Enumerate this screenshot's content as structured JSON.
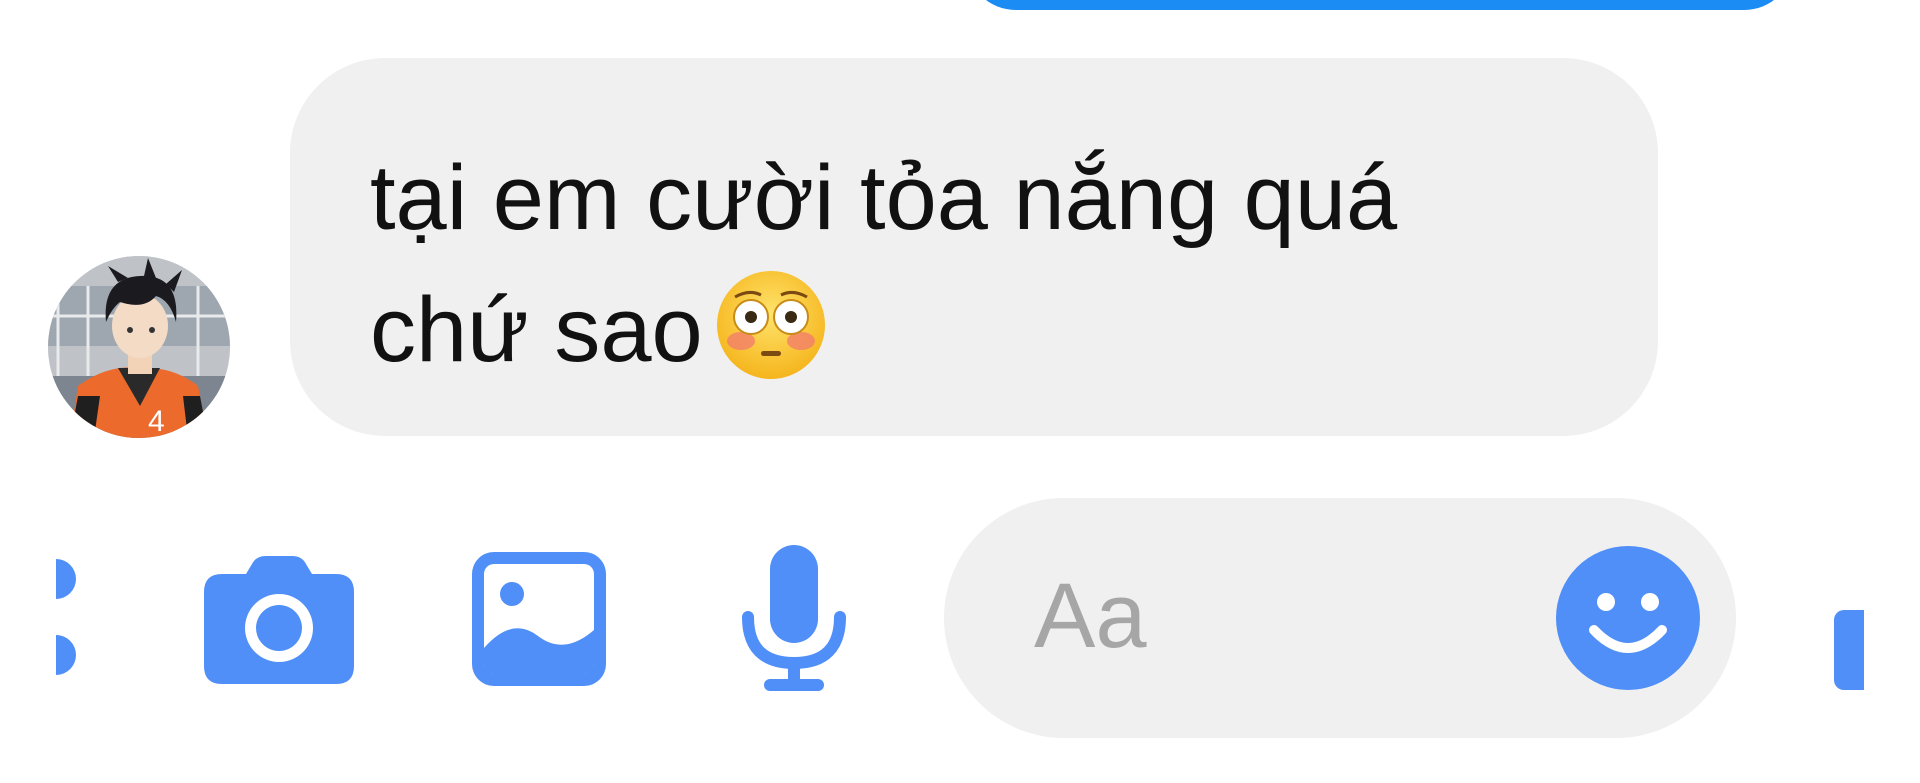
{
  "colors": {
    "accent": "#4f8ff7",
    "sent_bubble": "#1c8cf5",
    "received_bubble": "#f0f0f0",
    "placeholder": "#a6a6a6"
  },
  "conversation": {
    "messages": [
      {
        "direction": "outgoing",
        "text": ""
      },
      {
        "direction": "incoming",
        "text": "tại em cười tỏa nắng quá\nchứ sao",
        "emoji": "flushed-face-emoji",
        "avatar": "anime-volleyball-player-avatar"
      }
    ]
  },
  "composer": {
    "placeholder": "Aa",
    "value": "",
    "icons": [
      "more-icon",
      "camera-icon",
      "image-icon",
      "microphone-icon",
      "smiley-icon",
      "like-icon"
    ]
  }
}
